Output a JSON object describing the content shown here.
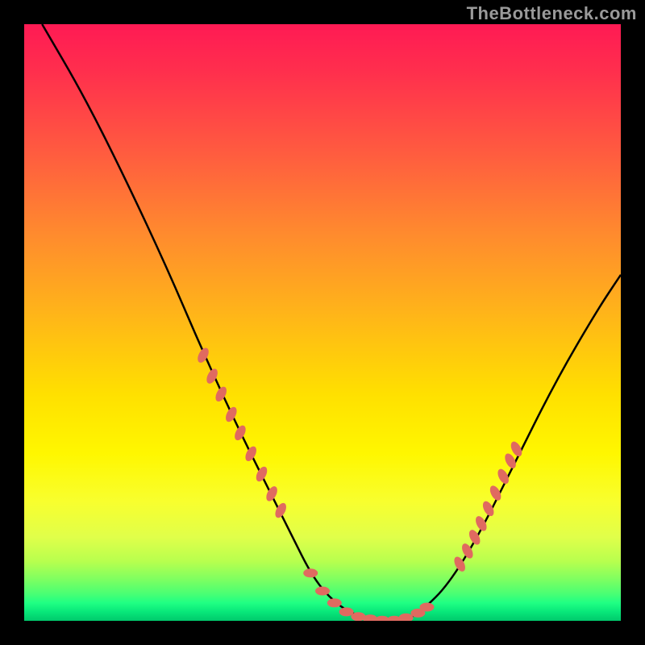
{
  "watermark": "TheBottleneck.com",
  "colors": {
    "background": "#000000",
    "gradient_top": "#ff1a54",
    "gradient_mid": "#ffe000",
    "gradient_bottom": "#00c96b",
    "curve": "#000000",
    "marker": "#e06a60",
    "watermark_text": "#9a9a9a"
  },
  "chart_data": {
    "type": "line",
    "title": "",
    "xlabel": "",
    "ylabel": "",
    "xlim": [
      0,
      100
    ],
    "ylim": [
      0,
      100
    ],
    "series": [
      {
        "name": "curve",
        "x": [
          3,
          10,
          17,
          24,
          30,
          36,
          41,
          45,
          48,
          51,
          55,
          60,
          64,
          67,
          71,
          76,
          82,
          89,
          96,
          100
        ],
        "y": [
          100,
          88,
          74,
          59,
          45,
          32,
          22,
          14,
          8,
          4,
          1,
          0,
          0,
          2,
          6,
          14,
          26,
          40,
          52,
          58
        ]
      }
    ],
    "markers_left": [
      {
        "x": 30.0,
        "y": 44.5
      },
      {
        "x": 31.5,
        "y": 41.0
      },
      {
        "x": 33.0,
        "y": 38.0
      },
      {
        "x": 34.7,
        "y": 34.6
      },
      {
        "x": 36.2,
        "y": 31.5
      },
      {
        "x": 38.0,
        "y": 28.0
      },
      {
        "x": 39.8,
        "y": 24.6
      },
      {
        "x": 41.5,
        "y": 21.3
      },
      {
        "x": 43.0,
        "y": 18.5
      }
    ],
    "markers_bottom": [
      {
        "x": 48.0,
        "y": 8.0
      },
      {
        "x": 50.0,
        "y": 5.0
      },
      {
        "x": 52.0,
        "y": 3.0
      },
      {
        "x": 54.0,
        "y": 1.5
      },
      {
        "x": 56.0,
        "y": 0.7
      },
      {
        "x": 58.0,
        "y": 0.3
      },
      {
        "x": 60.0,
        "y": 0.1
      },
      {
        "x": 62.0,
        "y": 0.1
      },
      {
        "x": 64.0,
        "y": 0.5
      },
      {
        "x": 66.0,
        "y": 1.3
      },
      {
        "x": 67.5,
        "y": 2.3
      }
    ],
    "markers_right": [
      {
        "x": 73.0,
        "y": 9.5
      },
      {
        "x": 74.3,
        "y": 11.7
      },
      {
        "x": 75.5,
        "y": 14.0
      },
      {
        "x": 76.6,
        "y": 16.3
      },
      {
        "x": 77.8,
        "y": 18.8
      },
      {
        "x": 79.0,
        "y": 21.4
      },
      {
        "x": 80.3,
        "y": 24.2
      },
      {
        "x": 81.5,
        "y": 26.8
      },
      {
        "x": 82.5,
        "y": 28.8
      }
    ]
  }
}
